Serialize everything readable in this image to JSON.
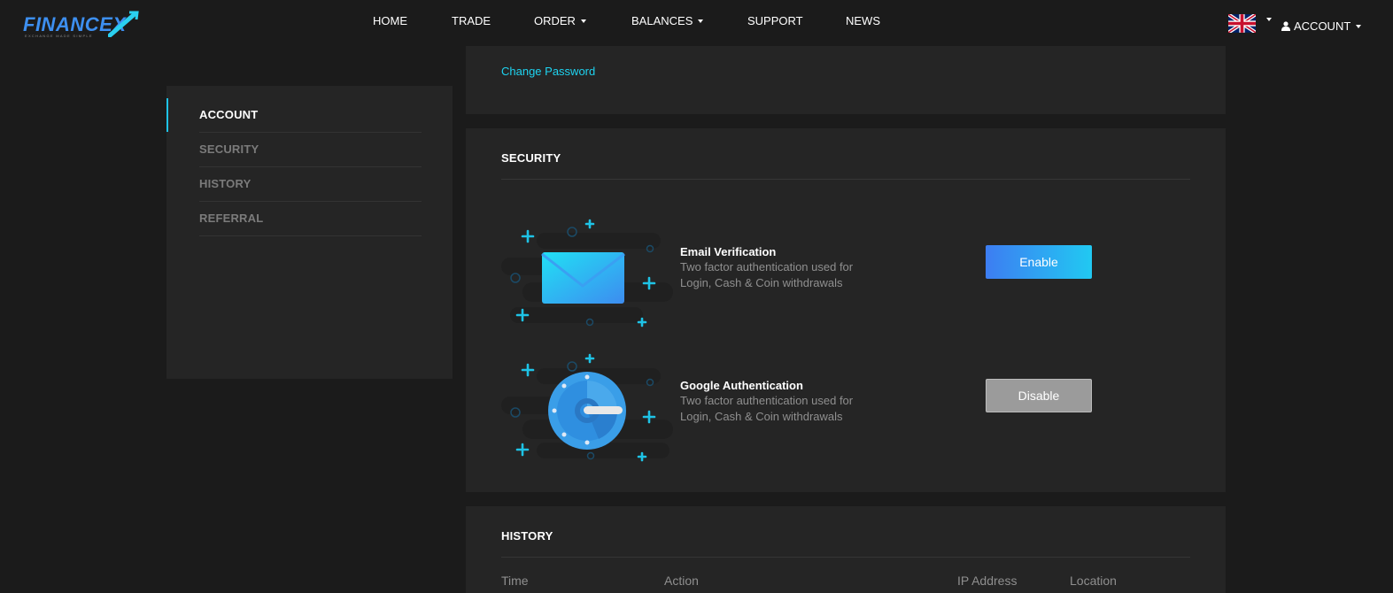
{
  "brand": {
    "name": "FINANCEX",
    "tagline": "EXCHANGE MADE SIMPLE"
  },
  "nav": {
    "home": "HOME",
    "trade": "TRADE",
    "order": "ORDER",
    "balances": "BALANCES",
    "support": "SUPPORT",
    "news": "NEWS",
    "account": "ACCOUNT"
  },
  "sidebar": {
    "items": [
      {
        "label": "ACCOUNT",
        "active": true
      },
      {
        "label": "SECURITY",
        "active": false
      },
      {
        "label": "HISTORY",
        "active": false
      },
      {
        "label": "REFERRAL",
        "active": false
      }
    ]
  },
  "account_panel": {
    "change_password_link": "Change Password"
  },
  "security": {
    "title": "SECURITY",
    "rows": [
      {
        "icon": "email-icon",
        "title": "Email Verification",
        "description": "Two factor authentication used for Login, Cash & Coin withdrawals",
        "button": "Enable"
      },
      {
        "icon": "google-authenticator-icon",
        "title": "Google Authentication",
        "description": "Two factor authentication used for Login, Cash & Coin withdrawals",
        "button": "Disable"
      }
    ]
  },
  "history": {
    "title": "HISTORY",
    "columns": [
      "Time",
      "Action",
      "IP Address",
      "Location"
    ]
  },
  "colors": {
    "accent": "#1ec3e6",
    "link": "#1ed3f0",
    "enable_gradient_start": "#3d7df2",
    "enable_gradient_end": "#21c9f2",
    "disable": "#9b9b9b",
    "panel": "#252525",
    "background": "#1b1b1b"
  }
}
